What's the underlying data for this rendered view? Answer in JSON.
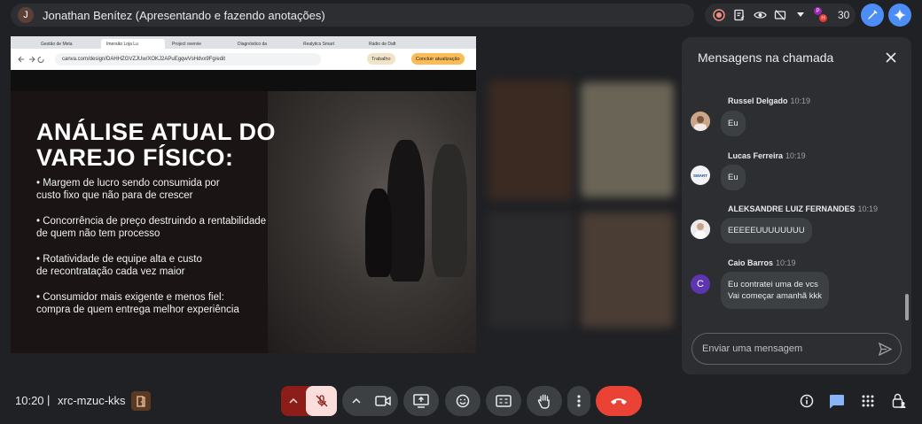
{
  "top_bar": {
    "presenter_initial": "J",
    "presenter_text": "Jonathan Benítez (Apresentando e fazendo anotações)",
    "participants_count": "30",
    "participant_badges": [
      "P",
      "H"
    ]
  },
  "browser": {
    "tabs": [
      "Gestão de Meta",
      "Imersão Loja Lu",
      "Project overvie",
      "Diagnóstico da",
      "Realytics Smart",
      "Rádio de Daft"
    ],
    "url": "canva.com/design/DAHHZGVZJUw/XOKJ2APuEgqwVsHdvx9Fg/edit",
    "btn_trabalho": "Trabalho",
    "btn_concluir": "Concluir atualização"
  },
  "slide": {
    "title_line1": "ANÁLISE ATUAL DO",
    "title_line2": "VAREJO FÍSICO:",
    "bullets": [
      {
        "l1": "• Margem de lucro sendo consumida por",
        "l2": "custo fixo que não para de crescer"
      },
      {
        "l1": " • Concorrência de preço destruindo a rentabilidade",
        "l2": "de quem não tem processo"
      },
      {
        "l1": " • Rotatividade de equipe alta e custo",
        "l2": "de recontratação cada vez maior"
      },
      {
        "l1": " • Consumidor mais exigente e menos fiel:",
        "l2": "compra de quem entrega melhor experiência"
      }
    ]
  },
  "chat": {
    "title": "Mensagens na chamada",
    "messages": [
      {
        "name": "Russel Delgado",
        "time": "10:19",
        "text": "Eu"
      },
      {
        "name": "Lucas Ferreira",
        "time": "10:19",
        "text": "Eu"
      },
      {
        "name": "ALEKSANDRE LUIZ FERNANDES",
        "time": "10:19",
        "text": "EEEEEUUUUUUUU"
      },
      {
        "name": "Caio Barros",
        "time": "10:19",
        "line1": "Eu contratei uma de vcs",
        "line2": "Vai começar amanhã kkk",
        "initial": "C"
      }
    ],
    "lucas_avatar_text": "SMART",
    "input_placeholder": "Enviar uma mensagem"
  },
  "bottom_bar": {
    "time": "10:20",
    "separator": "|",
    "meeting_code": "xrc-mzuc-kks"
  },
  "colors": {
    "end_call": "#ea4335",
    "mic_off": "#f9dedc",
    "mic_chevron": "#8c1d18",
    "chat_icon": "#8ab4f8",
    "gemini": "#4c8df6"
  }
}
